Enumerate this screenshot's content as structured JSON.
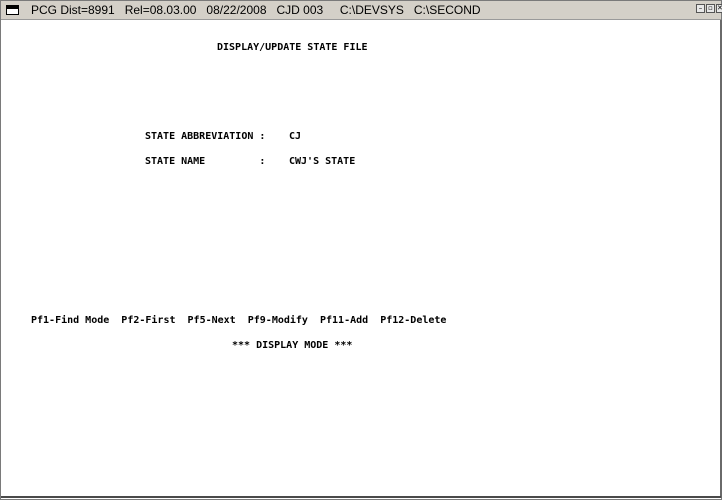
{
  "titlebar": {
    "title": "PCG Dist=8991   Rel=08.03.00   08/22/2008   CJD 003     C:\\DEVSYS   C:\\SECOND",
    "minimize_glyph": "–",
    "maximize_glyph": "▫",
    "close_glyph": "✕"
  },
  "screen": {
    "heading": "DISPLAY/UPDATE STATE FILE",
    "fields": [
      {
        "label": "STATE ABBREVIATION :",
        "value": "CJ"
      },
      {
        "label": "STATE NAME         :",
        "value": "CWJ'S STATE"
      }
    ],
    "function_keys": "Pf1-Find Mode  Pf2-First  Pf5-Next  Pf9-Modify  Pf11-Add  Pf12-Delete",
    "mode": "*** DISPLAY MODE ***"
  },
  "icons": {
    "app": "terminal-window-icon",
    "minimize": "minimize-icon",
    "maximize": "maximize-icon",
    "close": "close-icon"
  }
}
